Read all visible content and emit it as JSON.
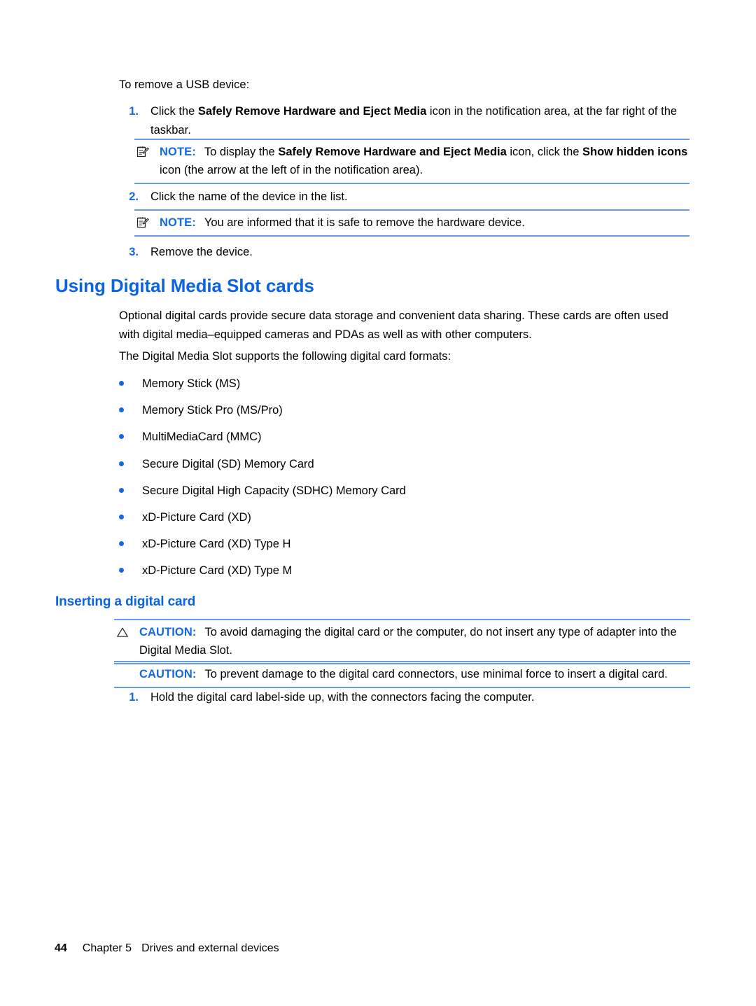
{
  "document": {
    "intro_line": "To remove a USB device:",
    "remove_steps": [
      {
        "number": "1.",
        "segments": [
          {
            "text": "Click the ",
            "bold": false
          },
          {
            "text": "Safely Remove Hardware and Eject Media",
            "bold": true
          },
          {
            "text": " icon in the notification area, at the far right of the taskbar.",
            "bold": false
          }
        ]
      },
      {
        "number": "2.",
        "segments": [
          {
            "text": "Click the name of the device in the list.",
            "bold": false
          }
        ]
      },
      {
        "number": "3.",
        "segments": [
          {
            "text": "Remove the device.",
            "bold": false
          }
        ]
      }
    ],
    "note_1": {
      "icon": "note-pad-pencil-icon",
      "label": "NOTE:",
      "segments": [
        {
          "text": "To display the ",
          "bold": false
        },
        {
          "text": "Safely Remove Hardware and Eject Media",
          "bold": true
        },
        {
          "text": " icon, click the ",
          "bold": false
        },
        {
          "text": "Show hidden icons",
          "bold": true
        },
        {
          "text": " icon (the arrow at the left of in the notification area).",
          "bold": false
        }
      ]
    },
    "note_2": {
      "icon": "note-pad-pencil-icon",
      "label": "NOTE:",
      "segments": [
        {
          "text": "You are informed that it is safe to remove the hardware device.",
          "bold": false
        }
      ]
    },
    "section_heading": "Using Digital Media Slot cards",
    "paragraph_1": "Optional digital cards provide secure data storage and convenient data sharing. These cards are often used with digital media–equipped cameras and PDAs as well as with other computers.",
    "paragraph_2": "The Digital Media Slot supports the following digital card formats:",
    "card_formats": [
      "Memory Stick (MS)",
      "Memory Stick Pro (MS/Pro)",
      "MultiMediaCard (MMC)",
      "Secure Digital (SD) Memory Card",
      "Secure Digital High Capacity (SDHC) Memory Card",
      "xD-Picture Card (XD)",
      "xD-Picture Card (XD) Type H",
      "xD-Picture Card (XD) Type M"
    ],
    "subsection_heading": "Inserting a digital card",
    "caution_1": {
      "icon": "warning-triangle-icon",
      "label": "CAUTION:",
      "segments": [
        {
          "text": "To avoid damaging the digital card or the computer, do not insert any type of adapter into the Digital Media Slot.",
          "bold": false
        }
      ]
    },
    "caution_2": {
      "icon": "none",
      "label": "CAUTION:",
      "segments": [
        {
          "text": "To prevent damage to the digital card connectors, use minimal force to insert a digital card.",
          "bold": false
        }
      ]
    },
    "insert_steps": [
      {
        "number": "1.",
        "segments": [
          {
            "text": "Hold the digital card label-side up, with the connectors facing the computer.",
            "bold": false
          }
        ]
      }
    ],
    "footer": {
      "page_number": "44",
      "chapter": "Chapter 5",
      "chapter_title": "Drives and external devices"
    },
    "colors": {
      "heading_blue": "#0A63E0",
      "accent_blue": "#1469E1",
      "rule_blue": "#6699E8",
      "text_black": "#000000"
    }
  }
}
